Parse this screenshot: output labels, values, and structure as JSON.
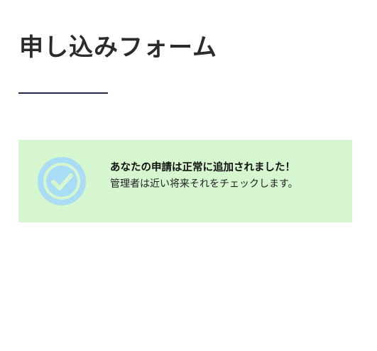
{
  "page": {
    "title": "申し込みフォーム"
  },
  "notice": {
    "icon": "check-circle-icon",
    "title": "あなたの申請は正常に追加されました！",
    "body": "管理者は近い将来それをチェックします。"
  },
  "colors": {
    "notice_background": "#d6f6cf",
    "icon_color": "#a9dcf5",
    "underline": "#1f2a44"
  }
}
